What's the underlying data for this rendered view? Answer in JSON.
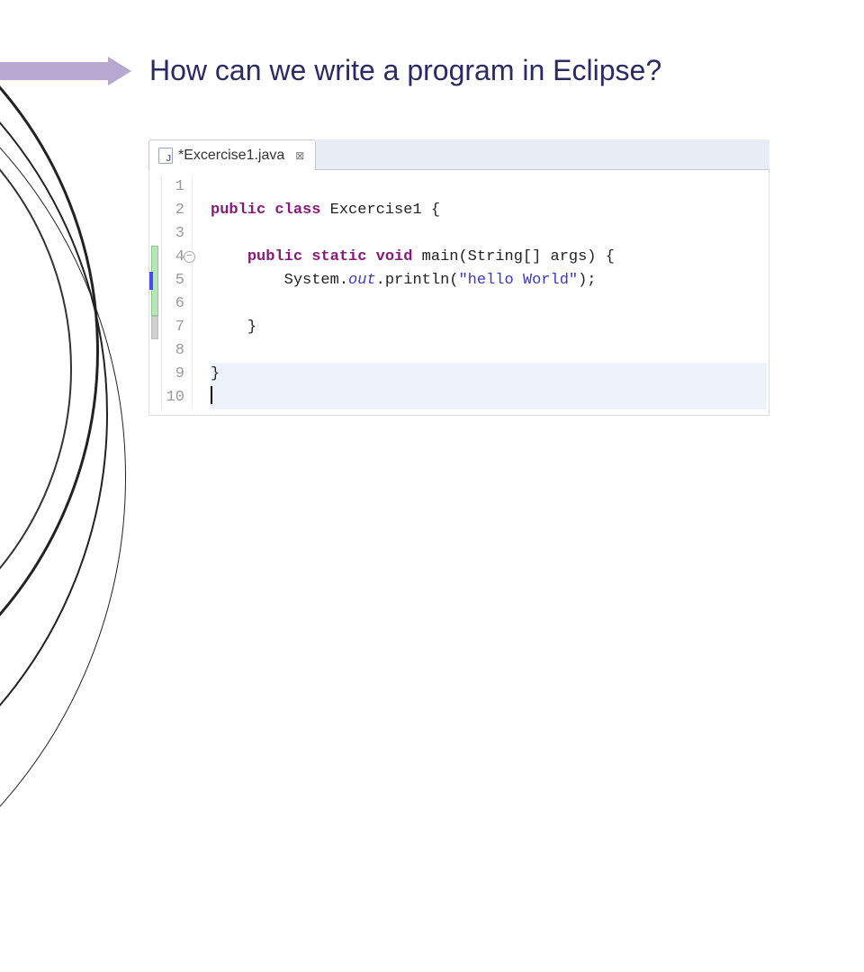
{
  "title": "How can we write a program in Eclipse?",
  "tab": {
    "filename": "*Excercise1.java",
    "close_glyph": "⊠"
  },
  "gutter": {
    "lines": [
      "1",
      "2",
      "3",
      "4",
      "5",
      "6",
      "7",
      "8",
      "9",
      "10"
    ],
    "fold_glyph": "−"
  },
  "code": {
    "l2": {
      "kw1": "public",
      "kw2": "class",
      "name": "Excercise1",
      "brace": " {"
    },
    "l4": {
      "kw1": "public",
      "kw2": "static",
      "kw3": "void",
      "sig": "main(String[] args) {"
    },
    "l5": {
      "call1": "System.",
      "field": "out",
      "call2": ".println(",
      "str": "\"hello World\"",
      "end": ");"
    },
    "l7": {
      "brace": "}"
    },
    "l9": {
      "brace": "}"
    }
  }
}
